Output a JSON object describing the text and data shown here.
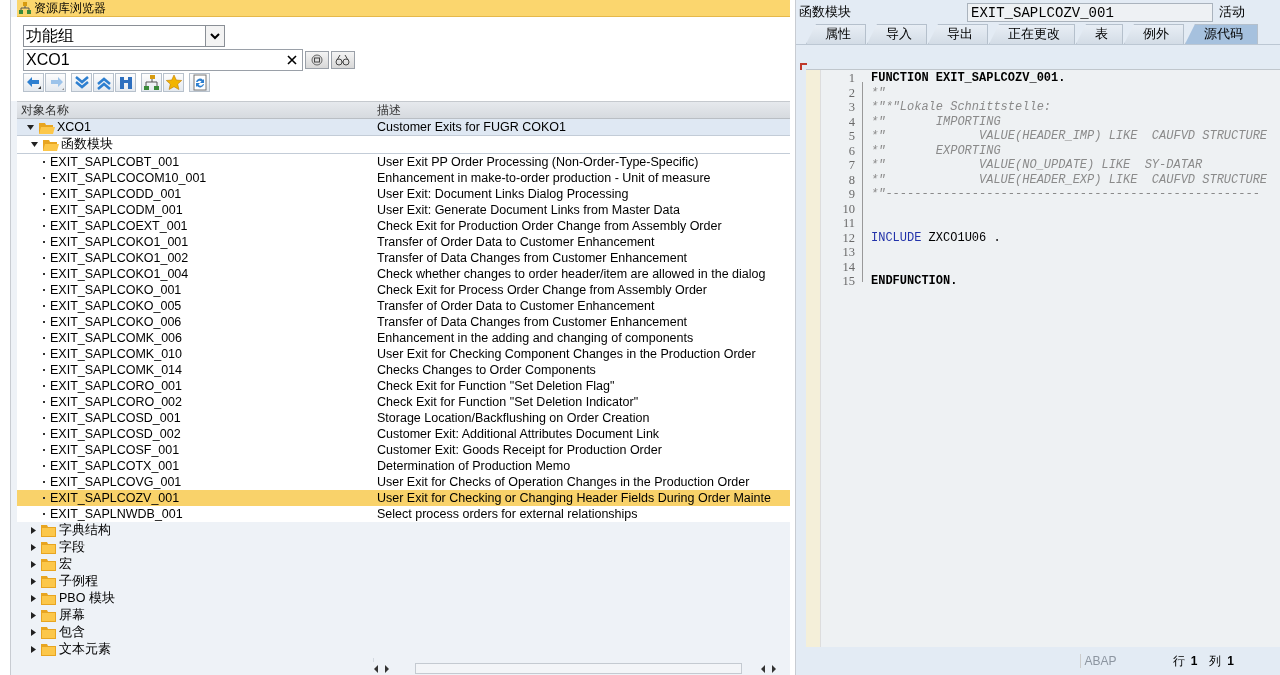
{
  "browser": {
    "title": "资源库浏览器",
    "object_type": "功能组",
    "search": {
      "value": "XCO1"
    },
    "columns": [
      "对象名称",
      "描述"
    ],
    "tree": [
      {
        "name": "XCO1",
        "description": "Customer Exits for FUGR COKO1",
        "kind": "folder",
        "expanded": true,
        "selected": false,
        "children": [
          {
            "name": "函数模块",
            "kind": "folder",
            "expanded": true,
            "selected": false,
            "children": [
              {
                "name": "EXIT_SAPLCOBT_001",
                "description": "User Exit PP Order Processing (Non-Order-Type-Specific)",
                "kind": "leaf",
                "selected": false
              },
              {
                "name": "EXIT_SAPLCOCOM10_001",
                "description": "Enhancement in make-to-order production - Unit of measure",
                "kind": "leaf",
                "selected": false
              },
              {
                "name": "EXIT_SAPLCODD_001",
                "description": "User Exit: Document Links Dialog Processing",
                "kind": "leaf",
                "selected": false
              },
              {
                "name": "EXIT_SAPLCODM_001",
                "description": "User Exit: Generate Document Links from Master Data",
                "kind": "leaf",
                "selected": false
              },
              {
                "name": "EXIT_SAPLCOEXT_001",
                "description": "Check Exit for Production Order Change from Assembly Order",
                "kind": "leaf",
                "selected": false
              },
              {
                "name": "EXIT_SAPLCOKO1_001",
                "description": "Transfer of Order Data to Customer Enhancement",
                "kind": "leaf",
                "selected": false
              },
              {
                "name": "EXIT_SAPLCOKO1_002",
                "description": "Transfer of Data Changes from Customer Enhancement",
                "kind": "leaf",
                "selected": false
              },
              {
                "name": "EXIT_SAPLCOKO1_004",
                "description": "Check whether changes to order header/item are allowed in the dialog",
                "kind": "leaf",
                "selected": false
              },
              {
                "name": "EXIT_SAPLCOKO_001",
                "description": "Check Exit for Process Order Change from Assembly Order",
                "kind": "leaf",
                "selected": false
              },
              {
                "name": "EXIT_SAPLCOKO_005",
                "description": "Transfer of Order Data to Customer Enhancement",
                "kind": "leaf",
                "selected": false
              },
              {
                "name": "EXIT_SAPLCOKO_006",
                "description": "Transfer of Data Changes from Customer Enhancement",
                "kind": "leaf",
                "selected": false
              },
              {
                "name": "EXIT_SAPLCOMK_006",
                "description": "Enhancement in the adding and changing of components",
                "kind": "leaf",
                "selected": false
              },
              {
                "name": "EXIT_SAPLCOMK_010",
                "description": "User Exit for Checking Component Changes in the Production Order",
                "kind": "leaf",
                "selected": false
              },
              {
                "name": "EXIT_SAPLCOMK_014",
                "description": "Checks Changes to Order Components",
                "kind": "leaf",
                "selected": false
              },
              {
                "name": "EXIT_SAPLCORO_001",
                "description": "Check Exit for Function \"Set Deletion Flag\"",
                "kind": "leaf",
                "selected": false
              },
              {
                "name": "EXIT_SAPLCORO_002",
                "description": "Check Exit for Function \"Set Deletion Indicator\"",
                "kind": "leaf",
                "selected": false
              },
              {
                "name": "EXIT_SAPLCOSD_001",
                "description": "Storage Location/Backflushing on Order Creation",
                "kind": "leaf",
                "selected": false
              },
              {
                "name": "EXIT_SAPLCOSD_002",
                "description": "Customer Exit: Additional Attributes Document Link",
                "kind": "leaf",
                "selected": false
              },
              {
                "name": "EXIT_SAPLCOSF_001",
                "description": "Customer Exit: Goods Receipt for Production Order",
                "kind": "leaf",
                "selected": false
              },
              {
                "name": "EXIT_SAPLCOTX_001",
                "description": "Determination of Production Memo",
                "kind": "leaf",
                "selected": false
              },
              {
                "name": "EXIT_SAPLCOVG_001",
                "description": "User Exit for Checks of Operation Changes in the Production Order",
                "kind": "leaf",
                "selected": false
              },
              {
                "name": "EXIT_SAPLCOZV_001",
                "description": "User Exit for Checking or Changing Header Fields During Order Mainte",
                "kind": "leaf",
                "selected": true
              },
              {
                "name": "EXIT_SAPLNWDB_001",
                "description": "Select process orders for external relationships",
                "kind": "leaf",
                "selected": false
              }
            ]
          },
          {
            "name": "字典结构",
            "kind": "folder",
            "expanded": false,
            "selected": false
          },
          {
            "name": "字段",
            "kind": "folder",
            "expanded": false,
            "selected": false
          },
          {
            "name": "宏",
            "kind": "folder",
            "expanded": false,
            "selected": false
          },
          {
            "name": "子例程",
            "kind": "folder",
            "expanded": false,
            "selected": false
          },
          {
            "name": "PBO 模块",
            "kind": "folder",
            "expanded": false,
            "selected": false
          },
          {
            "name": "屏幕",
            "kind": "folder",
            "expanded": false,
            "selected": false
          },
          {
            "name": "包含",
            "kind": "folder",
            "expanded": false,
            "selected": false
          },
          {
            "name": "文本元素",
            "kind": "folder",
            "expanded": false,
            "selected": false
          }
        ]
      }
    ]
  },
  "editor": {
    "label": "函数模块",
    "name": "EXIT_SAPLCOZV_001",
    "status": "活动",
    "tabs": [
      {
        "label": "属性",
        "selected": false
      },
      {
        "label": "导入",
        "selected": false
      },
      {
        "label": "导出",
        "selected": false
      },
      {
        "label": "正在更改",
        "selected": false
      },
      {
        "label": "表",
        "selected": false
      },
      {
        "label": "例外",
        "selected": false
      },
      {
        "label": "源代码",
        "selected": true
      }
    ],
    "lines": [
      {
        "number": "1",
        "segments": [
          {
            "text": "FUNCTION EXIT_SAPLCOZV_001.",
            "kind": "keyword"
          }
        ]
      },
      {
        "number": "2",
        "segments": [
          {
            "text": "*\"",
            "kind": "comment"
          }
        ]
      },
      {
        "number": "3",
        "segments": [
          {
            "text": "*\"*\"Lokale Schnittstelle:",
            "kind": "comment"
          }
        ]
      },
      {
        "number": "4",
        "segments": [
          {
            "text": "*\"       IMPORTING",
            "kind": "comment"
          }
        ]
      },
      {
        "number": "5",
        "segments": [
          {
            "text": "*\"             VALUE(HEADER_IMP) LIKE  CAUFVD STRUCTURE",
            "kind": "comment"
          }
        ]
      },
      {
        "number": "6",
        "segments": [
          {
            "text": "*\"       EXPORTING",
            "kind": "comment"
          }
        ]
      },
      {
        "number": "7",
        "segments": [
          {
            "text": "*\"             VALUE(NO_UPDATE) LIKE  SY-DATAR",
            "kind": "comment"
          }
        ]
      },
      {
        "number": "8",
        "segments": [
          {
            "text": "*\"             VALUE(HEADER_EXP) LIKE  CAUFVD STRUCTURE",
            "kind": "comment"
          }
        ]
      },
      {
        "number": "9",
        "segments": [
          {
            "text": "*\"----------------------------------------------------",
            "kind": "comment"
          }
        ]
      },
      {
        "number": "10"
      },
      {
        "number": "11"
      },
      {
        "number": "12",
        "segments": [
          {
            "text": "INCLUDE",
            "kind": "statement"
          },
          {
            "text": " ZXCO1U06 .",
            "kind": "plain"
          }
        ]
      },
      {
        "number": "13"
      },
      {
        "number": "14"
      },
      {
        "number": "15",
        "segments": [
          {
            "text": "ENDFUNCTION.",
            "kind": "keyword"
          }
        ]
      }
    ],
    "status_bar": {
      "language": "ABAP",
      "row_label": "行",
      "row": "1",
      "column_label": "列",
      "column": "1"
    }
  }
}
